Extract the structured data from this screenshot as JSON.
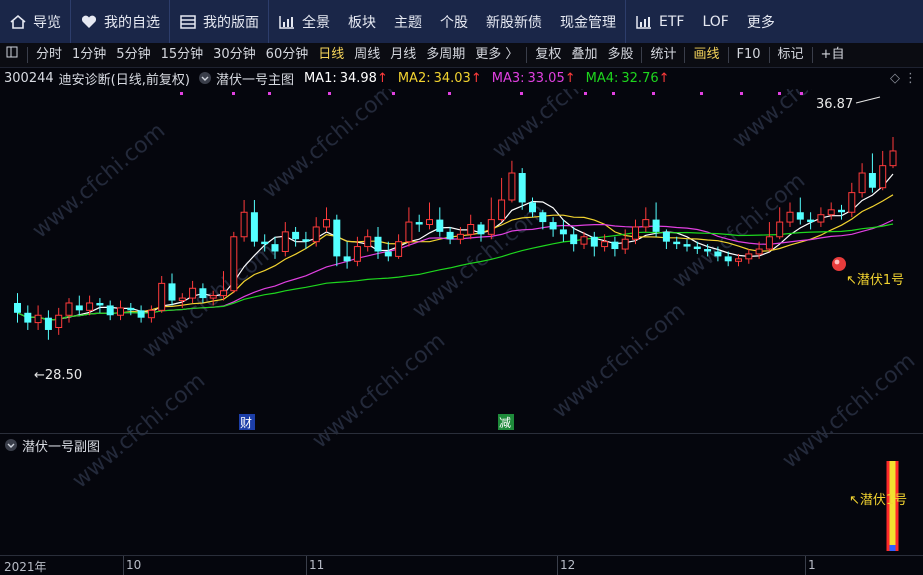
{
  "nav": {
    "items": [
      {
        "label": "导览",
        "icon": "home-icon"
      },
      {
        "label": "我的自选",
        "icon": "heart-icon"
      },
      {
        "label": "我的版面",
        "icon": "layout-icon"
      },
      {
        "label": "全景",
        "icon": "chart-bars-icon"
      },
      {
        "label": "板块"
      },
      {
        "label": "主题"
      },
      {
        "label": "个股"
      },
      {
        "label": "新股新债"
      },
      {
        "label": "现金管理"
      },
      {
        "label": "ETF",
        "icon": "chart-bars-icon"
      },
      {
        "label": "LOF"
      },
      {
        "label": "更多"
      }
    ]
  },
  "toolbar": {
    "periods": [
      "分时",
      "1分钟",
      "5分钟",
      "15分钟",
      "30分钟",
      "60分钟",
      "日线",
      "周线",
      "月线",
      "多周期",
      "更多 〉"
    ],
    "active_period": "日线",
    "tools": [
      "复权",
      "叠加",
      "多股",
      "统计",
      "画线",
      "F10",
      "标记",
      "+自"
    ],
    "active_tool": "画线"
  },
  "info": {
    "code": "300244",
    "name": "迪安诊断",
    "mode": "(日线,前复权)",
    "indicator": "潜伏一号主图",
    "ma": [
      {
        "label": "MA1:",
        "value": "34.98",
        "color": "#ffffff"
      },
      {
        "label": "MA2:",
        "value": "34.03",
        "color": "#f2d330"
      },
      {
        "label": "MA3:",
        "value": "33.05",
        "color": "#e040e0"
      },
      {
        "label": "MA4:",
        "value": "32.76",
        "color": "#1ed61e"
      }
    ]
  },
  "annotations": {
    "high": "36.87",
    "low": "←28.50",
    "signal": "↖潜伏1号",
    "badge_cai": "财",
    "badge_jian": "减"
  },
  "sub": {
    "title": "潜伏一号副图",
    "signal": "↖潜伏1号"
  },
  "xaxis": {
    "labels": [
      "2021年",
      "10",
      "11",
      "12",
      "1"
    ]
  },
  "colors": {
    "up": "#ff3b3b",
    "down": "#54ffff",
    "ma1": "#ffffff",
    "ma2": "#f2d330",
    "ma3": "#e040e0",
    "ma4": "#1ed61e",
    "nav_bg": "#1a2648"
  },
  "chart_data": {
    "type": "candlestick",
    "title": "300244 迪安诊断 (日线,前复权)",
    "ylim": [
      27,
      38.5
    ],
    "high_label": 36.87,
    "low_label": 28.5,
    "candles": [
      [
        30.1,
        29.7,
        30.5,
        29.3
      ],
      [
        29.7,
        29.3,
        30.0,
        29.0
      ],
      [
        29.3,
        29.6,
        30.0,
        29.0
      ],
      [
        29.5,
        29.0,
        29.8,
        28.6
      ],
      [
        29.1,
        29.6,
        29.9,
        28.8
      ],
      [
        29.6,
        30.1,
        30.3,
        29.3
      ],
      [
        30.0,
        29.8,
        30.4,
        29.6
      ],
      [
        29.8,
        30.1,
        30.4,
        29.6
      ],
      [
        30.1,
        30.0,
        30.3,
        29.7
      ],
      [
        30.0,
        29.6,
        30.2,
        29.4
      ],
      [
        29.6,
        29.9,
        30.2,
        29.4
      ],
      [
        29.9,
        29.8,
        30.1,
        29.6
      ],
      [
        29.8,
        29.5,
        30.0,
        29.3
      ],
      [
        29.5,
        29.8,
        30.0,
        29.3
      ],
      [
        29.8,
        30.9,
        31.2,
        29.7
      ],
      [
        30.9,
        30.2,
        31.3,
        30.0
      ],
      [
        30.2,
        30.3,
        30.5,
        29.9
      ],
      [
        30.3,
        30.7,
        31.0,
        30.1
      ],
      [
        30.7,
        30.3,
        30.9,
        30.1
      ],
      [
        30.3,
        30.4,
        30.6,
        30.0
      ],
      [
        30.4,
        30.6,
        31.4,
        30.2
      ],
      [
        30.6,
        32.8,
        33.0,
        30.5
      ],
      [
        32.8,
        33.8,
        34.3,
        32.6
      ],
      [
        33.8,
        32.6,
        34.3,
        32.4
      ],
      [
        32.6,
        32.5,
        32.9,
        32.2
      ],
      [
        32.5,
        32.2,
        32.8,
        31.9
      ],
      [
        32.2,
        33.0,
        33.4,
        32.0
      ],
      [
        33.0,
        32.7,
        33.2,
        32.4
      ],
      [
        32.7,
        32.6,
        33.0,
        32.3
      ],
      [
        32.6,
        33.2,
        33.6,
        32.4
      ],
      [
        33.2,
        33.5,
        34.0,
        33.0
      ],
      [
        33.5,
        32.0,
        33.7,
        31.6
      ],
      [
        32.0,
        31.8,
        32.6,
        31.5
      ],
      [
        31.8,
        32.4,
        32.8,
        31.6
      ],
      [
        32.4,
        32.8,
        33.1,
        32.2
      ],
      [
        32.8,
        32.2,
        33.2,
        31.9
      ],
      [
        32.2,
        32.0,
        32.6,
        31.8
      ],
      [
        32.0,
        32.6,
        32.9,
        31.9
      ],
      [
        32.6,
        33.4,
        34.0,
        32.4
      ],
      [
        33.4,
        33.3,
        33.7,
        33.0
      ],
      [
        33.3,
        33.5,
        34.2,
        33.1
      ],
      [
        33.5,
        33.0,
        34.0,
        32.8
      ],
      [
        33.0,
        32.7,
        33.2,
        32.5
      ],
      [
        32.7,
        32.9,
        33.2,
        32.5
      ],
      [
        32.9,
        33.3,
        33.7,
        32.7
      ],
      [
        33.3,
        32.9,
        33.4,
        32.6
      ],
      [
        32.9,
        33.5,
        34.4,
        32.7
      ],
      [
        33.5,
        34.3,
        35.2,
        33.4
      ],
      [
        34.3,
        35.4,
        35.9,
        34.2
      ],
      [
        35.4,
        34.2,
        35.6,
        33.9
      ],
      [
        34.2,
        33.8,
        34.4,
        33.6
      ],
      [
        33.8,
        33.4,
        33.9,
        33.1
      ],
      [
        33.4,
        33.1,
        33.6,
        32.8
      ],
      [
        33.1,
        32.9,
        33.5,
        32.6
      ],
      [
        32.9,
        32.5,
        33.2,
        32.2
      ],
      [
        32.5,
        32.8,
        33.0,
        32.3
      ],
      [
        32.8,
        32.4,
        33.0,
        32.0
      ],
      [
        32.4,
        32.6,
        32.9,
        32.2
      ],
      [
        32.6,
        32.3,
        32.8,
        32.0
      ],
      [
        32.3,
        32.7,
        33.1,
        32.1
      ],
      [
        32.7,
        33.2,
        33.5,
        32.5
      ],
      [
        33.2,
        33.5,
        34.0,
        33.0
      ],
      [
        33.5,
        33.0,
        34.2,
        32.8
      ],
      [
        33.0,
        32.6,
        33.1,
        32.3
      ],
      [
        32.6,
        32.5,
        32.8,
        32.3
      ],
      [
        32.5,
        32.4,
        32.7,
        32.2
      ],
      [
        32.4,
        32.3,
        32.6,
        32.1
      ],
      [
        32.3,
        32.2,
        32.5,
        32.0
      ],
      [
        32.2,
        32.0,
        32.4,
        31.8
      ],
      [
        32.0,
        31.8,
        32.2,
        31.6
      ],
      [
        31.8,
        31.9,
        32.1,
        31.6
      ],
      [
        31.9,
        32.1,
        32.3,
        31.7
      ],
      [
        32.1,
        32.3,
        32.6,
        31.9
      ],
      [
        32.3,
        32.8,
        33.4,
        32.2
      ],
      [
        32.8,
        33.4,
        34.0,
        32.7
      ],
      [
        33.4,
        33.8,
        34.2,
        33.2
      ],
      [
        33.8,
        33.5,
        34.4,
        33.3
      ],
      [
        33.5,
        33.4,
        33.8,
        33.1
      ],
      [
        33.4,
        33.7,
        34.0,
        33.2
      ],
      [
        33.7,
        33.9,
        34.2,
        33.5
      ],
      [
        33.9,
        33.8,
        34.1,
        33.5
      ],
      [
        33.8,
        34.6,
        35.0,
        33.6
      ],
      [
        34.6,
        35.4,
        35.8,
        34.4
      ],
      [
        35.4,
        34.8,
        36.2,
        34.6
      ],
      [
        34.8,
        35.7,
        36.3,
        34.7
      ],
      [
        35.7,
        36.3,
        36.87,
        35.6
      ]
    ],
    "x_ticks": [
      "2021年",
      "10",
      "11",
      "12",
      "1"
    ],
    "subchart": {
      "title": "潜伏一号副图",
      "signal_bar_index": 85
    }
  }
}
